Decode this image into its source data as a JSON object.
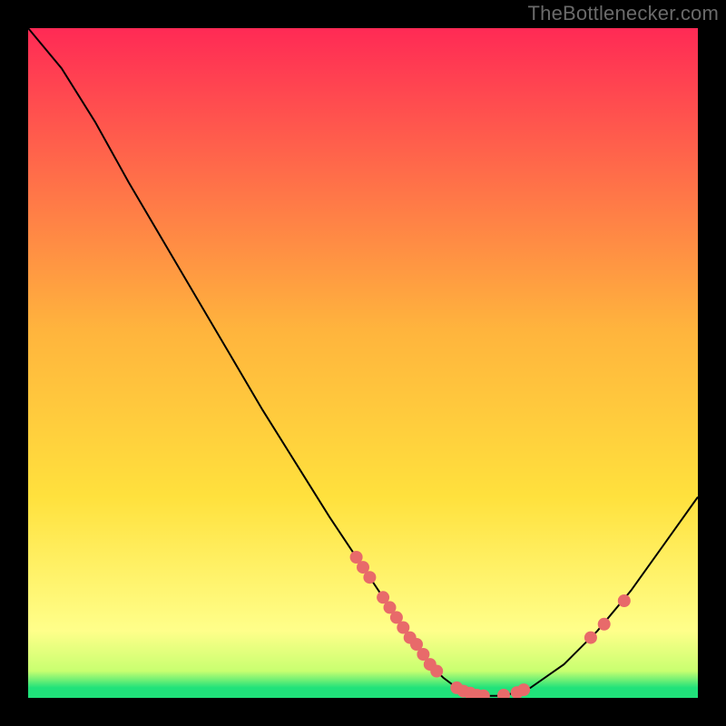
{
  "attribution": "TheBottlenecker.com",
  "colors": {
    "gradient_top": "#ff2a55",
    "gradient_mid": "#ffd23d",
    "gradient_bottom_band": "#ffff99",
    "gradient_green": "#20e27a",
    "gradient_very_bottom": "#4ad0ff",
    "curve": "#000000",
    "marker": "#e86a6a",
    "frame_bg": "#000000"
  },
  "chart_data": {
    "type": "line",
    "title": "",
    "xlabel": "",
    "ylabel": "",
    "xlim": [
      0,
      100
    ],
    "ylim": [
      0,
      100
    ],
    "series": [
      {
        "name": "bottleneck-curve",
        "x": [
          0,
          5,
          10,
          15,
          20,
          25,
          30,
          35,
          40,
          45,
          50,
          55,
          58,
          60,
          62,
          64,
          66,
          68,
          70,
          72,
          75,
          80,
          85,
          90,
          95,
          100
        ],
        "y": [
          100,
          94,
          86,
          77,
          68.5,
          60,
          51.5,
          43,
          35,
          27,
          19.5,
          12,
          8,
          5,
          3,
          1.5,
          0.7,
          0.3,
          0.3,
          0.6,
          1.5,
          5,
          10,
          16,
          23,
          30
        ]
      }
    ],
    "markers": [
      {
        "x": 49,
        "y": 21
      },
      {
        "x": 50,
        "y": 19.5
      },
      {
        "x": 51,
        "y": 18
      },
      {
        "x": 53,
        "y": 15
      },
      {
        "x": 54,
        "y": 13.5
      },
      {
        "x": 55,
        "y": 12
      },
      {
        "x": 56,
        "y": 10.5
      },
      {
        "x": 57,
        "y": 9
      },
      {
        "x": 58,
        "y": 8
      },
      {
        "x": 59,
        "y": 6.5
      },
      {
        "x": 60,
        "y": 5
      },
      {
        "x": 61,
        "y": 4
      },
      {
        "x": 64,
        "y": 1.5
      },
      {
        "x": 65,
        "y": 1
      },
      {
        "x": 66,
        "y": 0.7
      },
      {
        "x": 67,
        "y": 0.4
      },
      {
        "x": 68,
        "y": 0.3
      },
      {
        "x": 71,
        "y": 0.4
      },
      {
        "x": 73,
        "y": 0.8
      },
      {
        "x": 74,
        "y": 1.2
      },
      {
        "x": 84,
        "y": 9
      },
      {
        "x": 86,
        "y": 11
      },
      {
        "x": 89,
        "y": 14.5
      }
    ]
  }
}
